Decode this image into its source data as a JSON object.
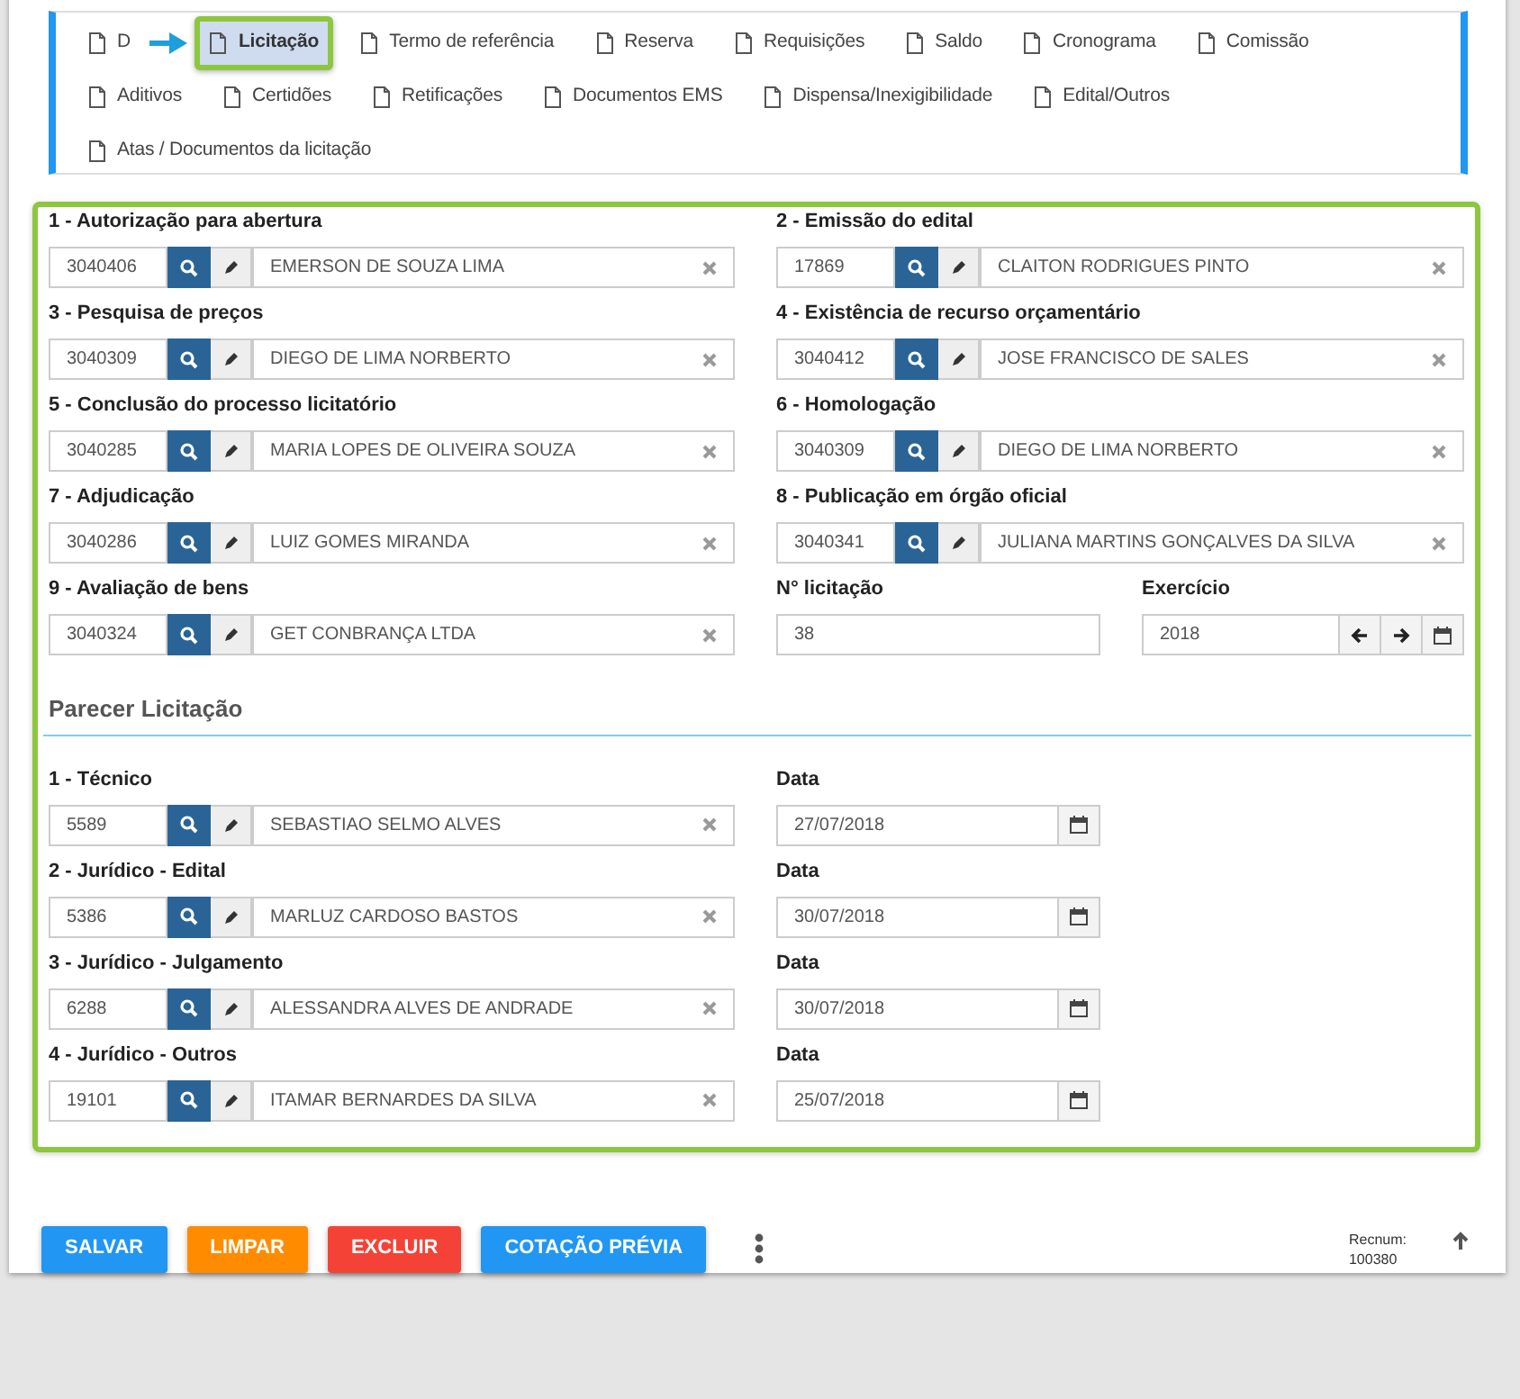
{
  "tabs": [
    {
      "label": "D",
      "selected": false
    },
    {
      "label": "Licitação",
      "selected": true
    },
    {
      "label": "Termo de referência",
      "selected": false
    },
    {
      "label": "Reserva",
      "selected": false
    },
    {
      "label": "Requisições",
      "selected": false
    },
    {
      "label": "Saldo",
      "selected": false
    },
    {
      "label": "Cronograma",
      "selected": false
    },
    {
      "label": "Comissão",
      "selected": false
    },
    {
      "label": "Aditivos",
      "selected": false
    },
    {
      "label": "Certidões",
      "selected": false
    },
    {
      "label": "Retificações",
      "selected": false
    },
    {
      "label": "Documentos EMS",
      "selected": false
    },
    {
      "label": "Dispensa/Inexigibilidade",
      "selected": false
    },
    {
      "label": "Edital/Outros",
      "selected": false
    },
    {
      "label": "Atas / Documentos da licitação",
      "selected": false
    }
  ],
  "form_rows": [
    [
      {
        "kind": "lookup",
        "label": "1 - Autorização para abertura",
        "code": "3040406",
        "name": "EMERSON DE SOUZA LIMA"
      },
      {
        "kind": "lookup",
        "label": "2 - Emissão do edital",
        "code": "17869",
        "name": "CLAITON RODRIGUES PINTO"
      }
    ],
    [
      {
        "kind": "lookup",
        "label": "3 - Pesquisa de preços",
        "code": "3040309",
        "name": "DIEGO DE LIMA NORBERTO"
      },
      {
        "kind": "lookup",
        "label": "4 - Existência de recurso orçamentário",
        "code": "3040412",
        "name": "JOSE FRANCISCO DE SALES"
      }
    ],
    [
      {
        "kind": "lookup",
        "label": "5 - Conclusão do processo licitatório",
        "code": "3040285",
        "name": "MARIA LOPES DE OLIVEIRA SOUZA"
      },
      {
        "kind": "lookup",
        "label": "6 - Homologação",
        "code": "3040309",
        "name": "DIEGO DE LIMA NORBERTO"
      }
    ],
    [
      {
        "kind": "lookup",
        "label": "7 - Adjudicação",
        "code": "3040286",
        "name": "LUIZ GOMES MIRANDA"
      },
      {
        "kind": "lookup",
        "label": "8 - Publicação em órgão oficial",
        "code": "3040341",
        "name": "JULIANA MARTINS GONÇALVES DA SILVA"
      }
    ],
    [
      {
        "kind": "lookup",
        "label": "9 - Avaliação de bens",
        "code": "3040324",
        "name": "GET CONBRANÇA LTDA"
      },
      {
        "kind": "text",
        "label": "N° licitação",
        "value": "38"
      },
      {
        "kind": "year",
        "label": "Exercício",
        "value": "2018"
      }
    ]
  ],
  "parecer": {
    "title": "Parecer Licitação",
    "rows": [
      [
        {
          "kind": "lookup",
          "label": "1 - Técnico",
          "code": "5589",
          "name": "SEBASTIAO SELMO ALVES"
        },
        {
          "kind": "date",
          "label": "Data",
          "value": "27/07/2018"
        }
      ],
      [
        {
          "kind": "lookup",
          "label": "2 - Jurídico - Edital",
          "code": "5386",
          "name": "MARLUZ CARDOSO BASTOS"
        },
        {
          "kind": "date",
          "label": "Data",
          "value": "30/07/2018"
        }
      ],
      [
        {
          "kind": "lookup",
          "label": "3 - Jurídico - Julgamento",
          "code": "6288",
          "name": "ALESSANDRA ALVES DE ANDRADE"
        },
        {
          "kind": "date",
          "label": "Data",
          "value": "30/07/2018"
        }
      ],
      [
        {
          "kind": "lookup",
          "label": "4 - Jurídico - Outros",
          "code": "19101",
          "name": "ITAMAR BERNARDES DA SILVA"
        },
        {
          "kind": "date",
          "label": "Data",
          "value": "25/07/2018"
        }
      ]
    ]
  },
  "actions": [
    {
      "label": "SALVAR",
      "color": "#2196f3"
    },
    {
      "label": "LIMPAR",
      "color": "#ff8c00"
    },
    {
      "label": "EXCLUIR",
      "color": "#f44336"
    },
    {
      "label": "COTAÇÃO PRÉVIA",
      "color": "#2196f3"
    }
  ],
  "recnum": {
    "label": "Recnum:",
    "value": "100380"
  }
}
